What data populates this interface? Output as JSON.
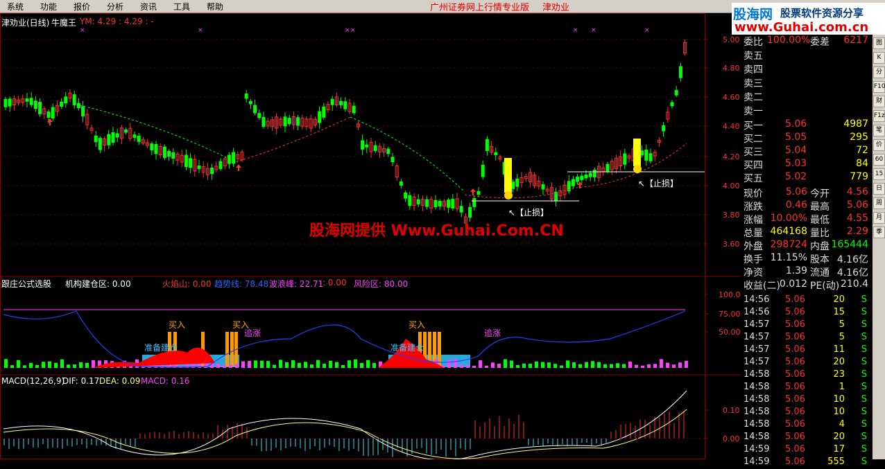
{
  "menu": [
    "系统",
    "功能",
    "报价",
    "分析",
    "资讯",
    "工具",
    "帮助"
  ],
  "title_center": "广州证券网上行情专业版",
  "stock_name": "津劝业",
  "logo": {
    "line1": "股海网",
    "line1b": "股票软件资源分享",
    "line2": "www.Guhai.com.cn"
  },
  "kline_header": {
    "name": "津劝业(日线)",
    "indicator": "牛魔王",
    "ym": "YM: 4.29 : 4.29 : -"
  },
  "price_axis": [
    "5.00",
    "4.80",
    "4.60",
    "4.40",
    "4.20",
    "4.00",
    "3.80",
    "3.60"
  ],
  "stop_labels": [
    "↖【止损】",
    "↖【止损】"
  ],
  "watermark": "股海网提供 Www.Guhai.Com.CN",
  "ind2_header": {
    "name": "跟庄公式选股",
    "items": [
      {
        "label": "机构建仓区: 0.00",
        "color": "#ffffff"
      },
      {
        "label": "火焰山: 0.00",
        "color": "#ff3030"
      },
      {
        "label": "趋势线: 78.48",
        "color": "#3060ff"
      },
      {
        "label": "波浪峰: 22.71",
        "color": "#ff40ff"
      },
      {
        "label": ": 0.00",
        "color": "#ff3030"
      },
      {
        "label": "风险区: 80.00",
        "color": "#ff40ff"
      }
    ]
  },
  "ind2_axis": [
    "100.0",
    "75.00",
    "50.00"
  ],
  "ind2_labels": {
    "buy": "买入",
    "chase": "追涨",
    "prep": "准备建仓"
  },
  "macd_header": {
    "name": "MACD(12,26,9)",
    "dif": "DIF: 0.17",
    "dea": "DEA: 0.09",
    "macd": "MACD: 0.16"
  },
  "macd_axis": [
    "0.10",
    "0.00"
  ],
  "quote": {
    "wb": {
      "label": "委比",
      "value": "100.00%",
      "label2": "委差",
      "value2": "6217"
    },
    "sell": [
      {
        "label": "卖五"
      },
      {
        "label": "卖四"
      },
      {
        "label": "卖三"
      },
      {
        "label": "卖二"
      },
      {
        "label": "卖一"
      }
    ],
    "buy": [
      {
        "label": "买一",
        "price": "5.06",
        "vol": "4987"
      },
      {
        "label": "买二",
        "price": "5.05",
        "vol": "295"
      },
      {
        "label": "买三",
        "price": "5.04",
        "vol": "72"
      },
      {
        "label": "买四",
        "price": "5.03",
        "vol": "84"
      },
      {
        "label": "买五",
        "price": "5.02",
        "vol": "779"
      }
    ],
    "stats": [
      {
        "l1": "现价",
        "v1": "5.06",
        "l2": "今开",
        "v2": "4.56",
        "c1": "#ff3030",
        "c2": "#ff3030"
      },
      {
        "l1": "涨跌",
        "v1": "0.46",
        "l2": "最高",
        "v2": "5.06",
        "c1": "#ff3030",
        "c2": "#ff3030"
      },
      {
        "l1": "涨幅",
        "v1": "10.00%",
        "l2": "最低",
        "v2": "4.55",
        "c1": "#ff3030",
        "c2": "#ff3030"
      },
      {
        "l1": "总量",
        "v1": "464168",
        "l2": "量比",
        "v2": "2.29",
        "c1": "#ffff00",
        "c2": "#ff3030"
      },
      {
        "l1": "外盘",
        "v1": "298724",
        "l2": "内盘",
        "v2": "165444",
        "c1": "#ff3030",
        "c2": "#00ff00"
      },
      {
        "l1": "换手",
        "v1": "11.15%",
        "l2": "股本",
        "v2": "4.16亿",
        "c1": "#dddddd",
        "c2": "#dddddd"
      },
      {
        "l1": "净资",
        "v1": "1.39",
        "l2": "流通",
        "v2": "4.16亿",
        "c1": "#dddddd",
        "c2": "#dddddd"
      },
      {
        "l1": "收益(二)",
        "v1": "0.012",
        "l2": "PE(动)",
        "v2": "210.4",
        "c1": "#dddddd",
        "c2": "#dddddd"
      }
    ],
    "ticks": [
      {
        "t": "14:56",
        "p": "5.06",
        "v": "20",
        "s": "S"
      },
      {
        "t": "14:56",
        "p": "5.06",
        "v": "15",
        "s": "S"
      },
      {
        "t": "14:57",
        "p": "5.06",
        "v": "5",
        "s": "S"
      },
      {
        "t": "14:57",
        "p": "5.06",
        "v": "5",
        "s": "S"
      },
      {
        "t": "14:57",
        "p": "5.06",
        "v": "11",
        "s": "S"
      },
      {
        "t": "14:57",
        "p": "5.06",
        "v": "20",
        "s": "S"
      },
      {
        "t": "14:58",
        "p": "5.06",
        "v": "23",
        "s": "S"
      },
      {
        "t": "14:58",
        "p": "5.06",
        "v": "1",
        "s": "S"
      },
      {
        "t": "14:58",
        "p": "5.06",
        "v": "10",
        "s": "S"
      },
      {
        "t": "14:58",
        "p": "5.06",
        "v": "10",
        "s": "S"
      },
      {
        "t": "14:58",
        "p": "5.06",
        "v": "4",
        "s": "S"
      },
      {
        "t": "14:58",
        "p": "5.06",
        "v": "20",
        "s": "S"
      },
      {
        "t": "14:59",
        "p": "5.06",
        "v": "17",
        "s": "S"
      },
      {
        "t": "14:59",
        "p": "5.06",
        "v": "555",
        "s": "S"
      }
    ]
  },
  "toolbar": [
    "图",
    "K",
    "分",
    "F10",
    "财",
    "F1z",
    "笔",
    "价",
    "60",
    "15",
    "日",
    "周",
    "月",
    "季"
  ],
  "colors": {
    "up": "#ff3030",
    "down": "#00ff00",
    "grid": "#8b0000",
    "ma": "#00ff00"
  }
}
